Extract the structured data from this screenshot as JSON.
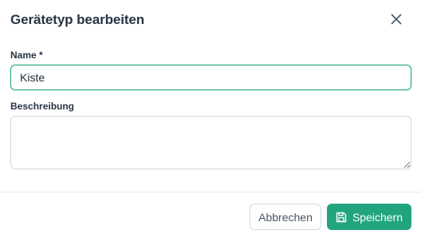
{
  "dialog": {
    "title": "Gerätetyp bearbeiten",
    "close_icon": "close-icon"
  },
  "form": {
    "name_label": "Name *",
    "name_value": "Kiste",
    "description_label": "Beschreibung",
    "description_value": ""
  },
  "footer": {
    "cancel_label": "Abbrechen",
    "save_label": "Speichern",
    "save_icon": "save-icon"
  },
  "colors": {
    "accent": "#22a57e",
    "focus_border": "#26a783",
    "text": "#283445"
  }
}
